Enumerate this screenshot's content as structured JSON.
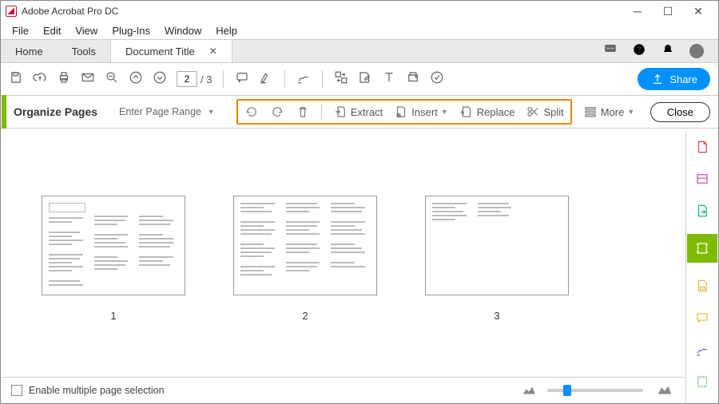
{
  "app": {
    "title": "Adobe Acrobat Pro DC"
  },
  "menu": [
    "File",
    "Edit",
    "View",
    "Plug-Ins",
    "Window",
    "Help"
  ],
  "tabs": {
    "home": "Home",
    "tools": "Tools",
    "doc": "Document Title"
  },
  "toolbar": {
    "page_current": "2",
    "page_total": "/ 3",
    "share": "Share"
  },
  "organize": {
    "title": "Organize Pages",
    "page_range": "Enter Page Range",
    "extract": "Extract",
    "insert": "Insert",
    "replace": "Replace",
    "split": "Split",
    "more": "More",
    "close": "Close"
  },
  "thumbs": [
    {
      "label": "1"
    },
    {
      "label": "2"
    },
    {
      "label": "3"
    }
  ],
  "footer": {
    "multi_select": "Enable multiple page selection"
  },
  "colors": {
    "accent_green": "#7fba00",
    "accent_blue": "#0091ff",
    "highlight": "#e38b00"
  }
}
